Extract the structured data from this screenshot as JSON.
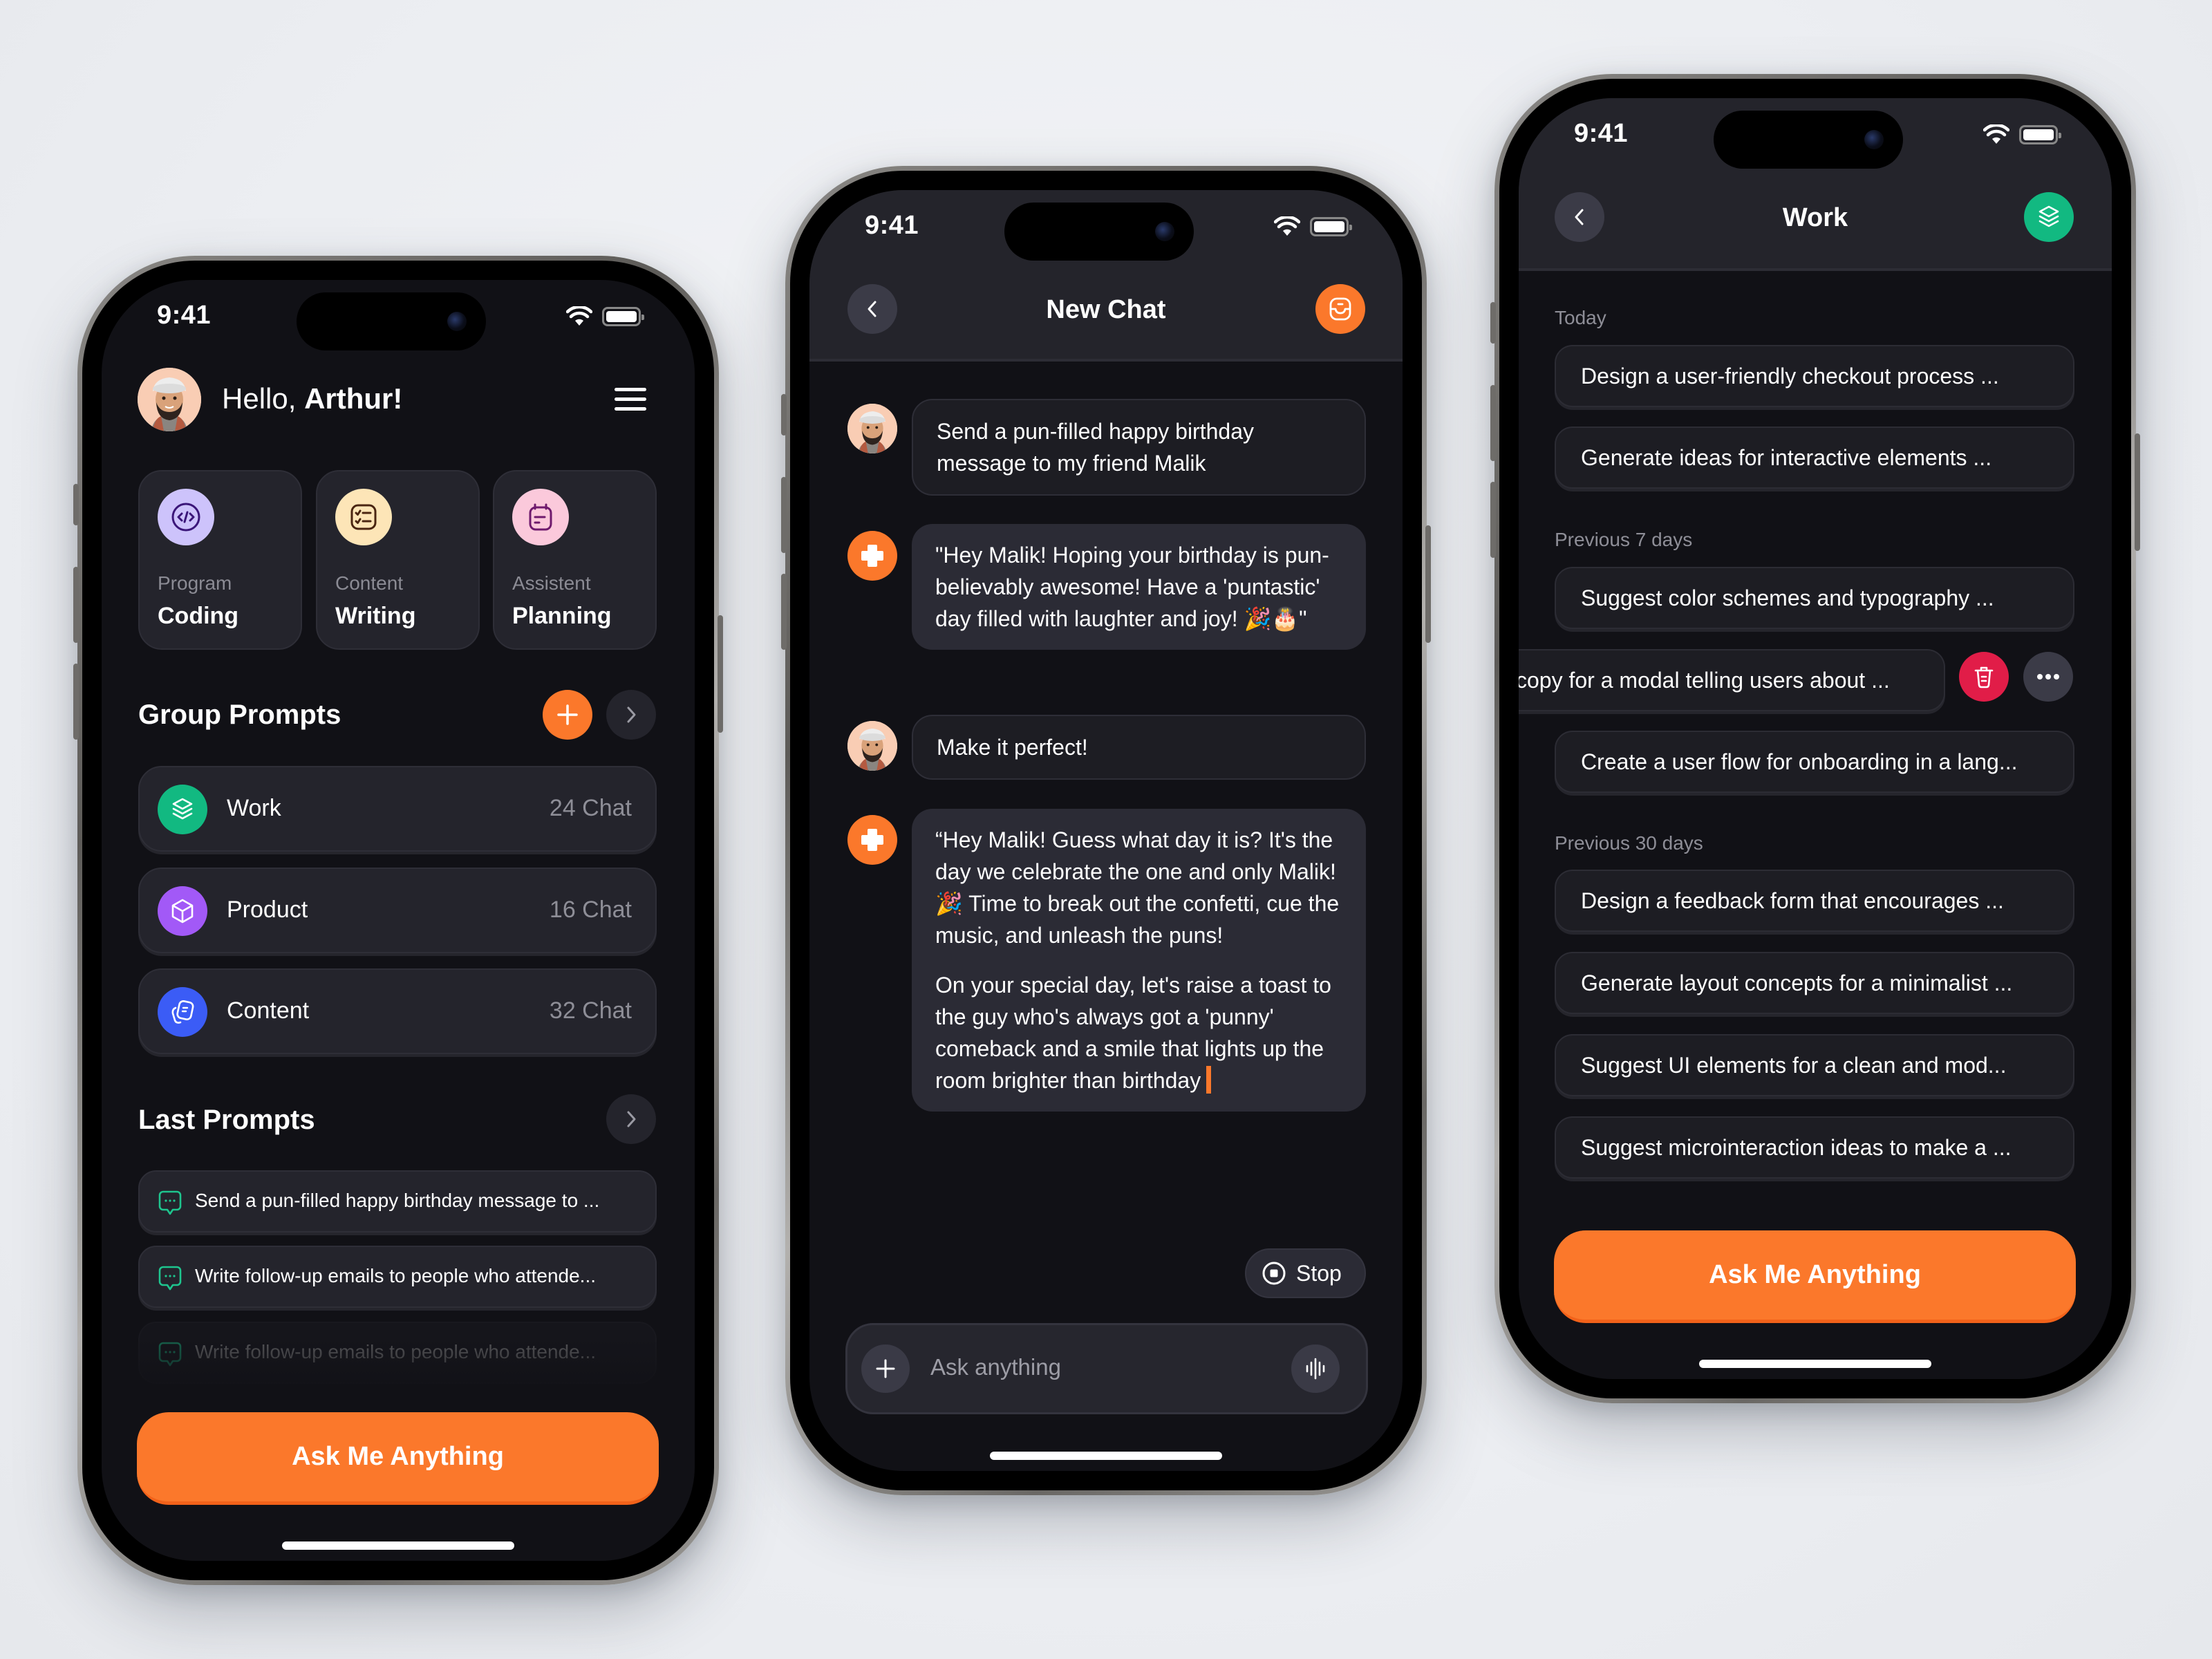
{
  "status_bar": {
    "time": "9:41"
  },
  "home": {
    "greeting_prefix": "Hello, ",
    "user_name": "Arthur!",
    "quick_actions": [
      {
        "subtitle": "Program",
        "title": "Coding",
        "icon": "code-icon",
        "bg": "#cdc3fb",
        "fg": "#3b1679"
      },
      {
        "subtitle": "Content",
        "title": "Writing",
        "icon": "checklist-icon",
        "bg": "#fde5b7",
        "fg": "#4a2511"
      },
      {
        "subtitle": "Assistent",
        "title": "Planning",
        "icon": "calendar-icon",
        "bg": "#fbc9db",
        "fg": "#6f1a6d"
      }
    ],
    "group_prompts": {
      "title": "Group Prompts",
      "items": [
        {
          "name": "Work",
          "count": "24 Chat",
          "icon": "layers-icon",
          "color": "#12b981"
        },
        {
          "name": "Product",
          "count": "16 Chat",
          "icon": "box-icon",
          "color": "#a259f7"
        },
        {
          "name": "Content",
          "count": "32 Chat",
          "icon": "cards-icon",
          "color": "#3b5cf6"
        }
      ]
    },
    "last_prompts": {
      "title": "Last Prompts",
      "items": [
        "Send a pun-filled happy birthday message to ...",
        "Write follow-up emails to people who attende...",
        "Write follow-up emails to people who attende..."
      ]
    },
    "cta_label": "Ask Me Anything"
  },
  "chat": {
    "title": "New Chat",
    "messages": [
      {
        "role": "user",
        "text": "Send a pun-filled happy birthday message to my friend Malik"
      },
      {
        "role": "assistant",
        "text": "\"Hey Malik! Hoping your birthday is pun-believably awesome! Have a 'puntastic' day filled with laughter and joy! 🎉🎂\""
      },
      {
        "role": "user",
        "text": "Make it perfect!"
      },
      {
        "role": "assistant",
        "paragraphs": [
          "“Hey Malik! Guess what day it is? It's the day we celebrate the one and only Malik! 🎉 Time to break out the confetti, cue the music, and unleash the puns!",
          "On your special day, let's raise a toast to the guy who's always got a 'punny' comeback and a smile that lights up the room brighter than birthday"
        ]
      }
    ],
    "stop_label": "Stop",
    "input_placeholder": "Ask anything"
  },
  "work": {
    "title": "Work",
    "sections": [
      {
        "label": "Today",
        "items": [
          "Design a user-friendly checkout process ...",
          "Generate ideas for interactive elements ..."
        ]
      },
      {
        "label": "Previous 7 days",
        "items": [
          "Suggest color schemes and typography ...",
          "copy for a modal telling users about ...",
          "Create a user flow for onboarding in a lang..."
        ]
      },
      {
        "label": "Previous 30 days",
        "items": [
          "Design a feedback form that encourages ...",
          "Generate layout concepts for a minimalist ...",
          "Suggest UI elements for a clean and mod...",
          "Suggest microinteraction ideas to make a ..."
        ]
      }
    ],
    "cta_label": "Ask Me Anything"
  },
  "colors": {
    "accent": "#fb782b",
    "danger": "#e11d48",
    "work_green": "#12b981"
  }
}
